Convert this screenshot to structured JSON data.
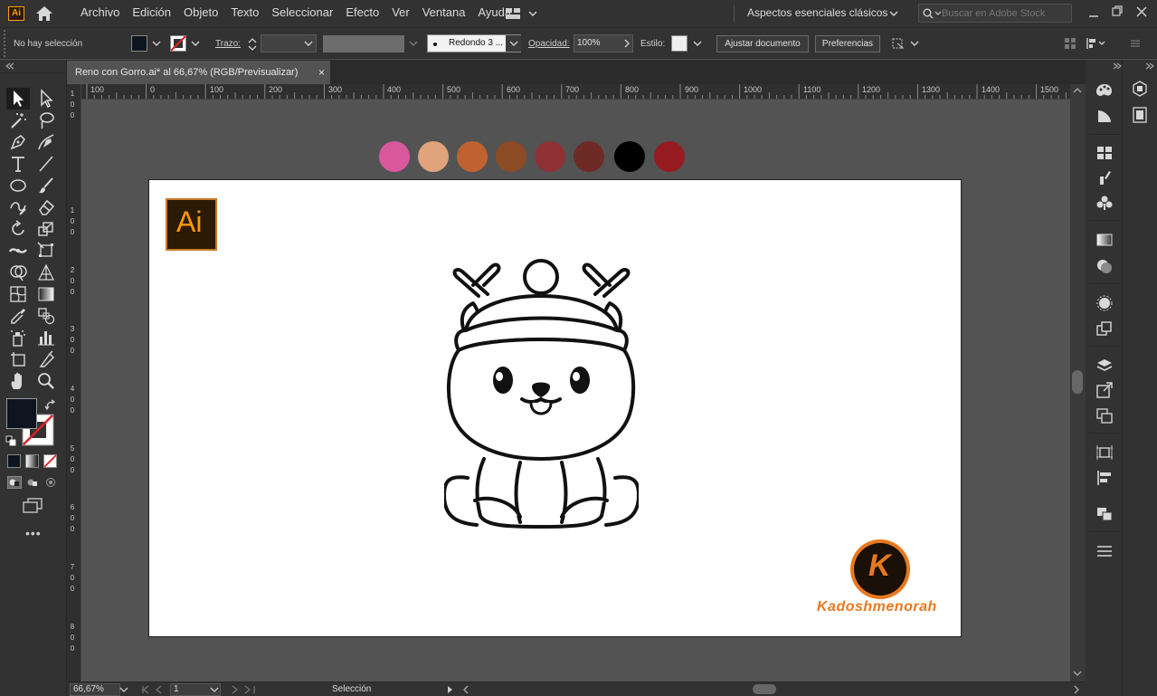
{
  "app": {
    "icon_label": "Ai"
  },
  "menubar": {
    "items": [
      "Archivo",
      "Edición",
      "Objeto",
      "Texto",
      "Seleccionar",
      "Efecto",
      "Ver",
      "Ventana",
      "Ayuda"
    ],
    "workspace": "Aspectos esenciales clásicos",
    "search_placeholder": "Buscar en Adobe Stock"
  },
  "control": {
    "selection_status": "No hay selección",
    "stroke_label": "Trazo:",
    "brush_value": "Redondo 3 ...",
    "opacity_label": "Opacidad:",
    "opacity_value": "100%",
    "style_label": "Estilo:",
    "adjust_button": "Ajustar documento",
    "prefs_button": "Preferencias"
  },
  "document": {
    "tab_title": "Reno con Gorro.ai* al 66,67% (RGB/Previsualizar)",
    "close_glyph": "×"
  },
  "ruler": {
    "h_ticks": [
      "100",
      "0",
      "100",
      "200",
      "300",
      "400",
      "500",
      "600",
      "700",
      "800",
      "900",
      "1000",
      "1100",
      "1200",
      "1300",
      "1400",
      "1500"
    ],
    "v_ticks": [
      "1",
      "0",
      "0",
      "1",
      "0",
      "0",
      "2",
      "0",
      "0",
      "3",
      "0",
      "0",
      "4",
      "0",
      "0",
      "5",
      "0",
      "0",
      "6",
      "0",
      "0",
      "7",
      "0",
      "0",
      "8",
      "0",
      "0"
    ]
  },
  "swatches": [
    "#d9579d",
    "#e0a37b",
    "#c0622f",
    "#8c4b22",
    "#8f3135",
    "#6e2b26",
    "#000000",
    "#951b21"
  ],
  "logo": {
    "ai_label": "Ai",
    "k_letter": "K",
    "brand_name": "Kadoshmenorah"
  },
  "status": {
    "zoom": "66,67%",
    "artboard_num": "1",
    "tool_name": "Selección"
  },
  "colors": {
    "ai_orange": "#ff9a00",
    "ai_bg": "#2b1a04",
    "brand_orange": "#e8781e",
    "k_circle": "#1a1008",
    "fill_swatch": "#0e1520"
  }
}
